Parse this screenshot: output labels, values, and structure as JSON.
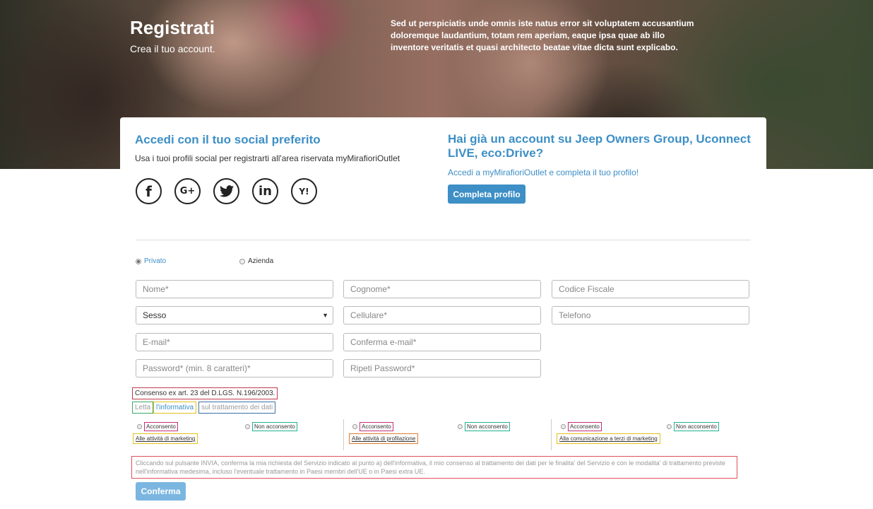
{
  "hero": {
    "title": "Registrati",
    "subtitle": "Crea il tuo account.",
    "text": "Sed ut perspiciatis unde omnis iste natus error sit voluptatem accusantium doloremque laudantium, totam rem aperiam, eaque ipsa quae ab illo inventore veritatis et quasi architecto beatae vitae dicta sunt explicabo."
  },
  "social": {
    "title": "Accedi con il tuo social preferito",
    "description": "Usa i tuoi profili social per registrarti all'area riservata myMirafioriOutlet",
    "icons": [
      {
        "name": "facebook-icon",
        "glyph": "f"
      },
      {
        "name": "google-plus-icon",
        "glyph": "G+"
      },
      {
        "name": "twitter-icon",
        "glyph": "🐦"
      },
      {
        "name": "linkedin-icon",
        "glyph": "in"
      },
      {
        "name": "yahoo-icon",
        "glyph": "Y!"
      }
    ]
  },
  "account": {
    "title": "Hai già un account su Jeep Owners Group, Uconnect LIVE, eco:Drive?",
    "link": "Accedi a myMirafioriOutlet e completa il tuo profilo!",
    "button": "Completa profilo"
  },
  "type": {
    "private_label": "Privato",
    "company_label": "Azienda",
    "selected": "Privato"
  },
  "form": {
    "nome": "Nome*",
    "cognome": "Cognome*",
    "codice_fiscale": "Codice Fiscale",
    "sesso": "Sesso",
    "cellulare": "Cellulare*",
    "telefono": "Telefono",
    "email": "E-mail*",
    "conferma_email": "Conferma e-mail*",
    "password": "Password* (min. 8 caratteri)*",
    "ripeti_password": "Ripeti Password*"
  },
  "consent": {
    "heading": "Consenso ex art. 23 del D.LGS. N.196/2003.",
    "read_prefix": "Letta",
    "read_link": "l'informativa",
    "read_suffix": "sul trattamento dei dati",
    "groups": [
      {
        "accept": "Acconsento",
        "deny": "Non acconsento",
        "purpose": "Alle attività di marketing"
      },
      {
        "accept": "Acconsento",
        "deny": "Non acconsento",
        "purpose": "Alle attività di profilazione"
      },
      {
        "accept": "Acconsento",
        "deny": "Non acconsento",
        "purpose": "Alla comunicazione a terzi di marketing"
      }
    ],
    "legal": "Cliccando sul pulsante INVIA, conferma la mia richiesta del Servizio indicato al punto a) dell'informativa, il mio consenso al trattamento dei dati per le finalita' del Servizio e con le modalita' di trattamento previste nell'informativa medesima, incluso l'eventuale trattamento in Paesi membri dell'UE o in Paesi extra UE."
  },
  "submit": {
    "label": "Conferma"
  }
}
